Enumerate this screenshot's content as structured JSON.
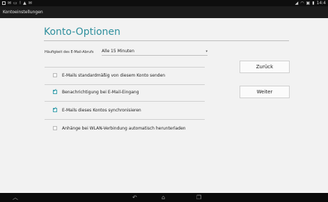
{
  "status_bar": {
    "left_icons": [
      "image-icon",
      "email-icon",
      "message-icon",
      "info-icon",
      "warning-icon",
      "mail-icon"
    ],
    "right_icons": [
      "signal-icon",
      "wifi-icon",
      "notification-icon",
      "battery-icon"
    ],
    "time": "14:4"
  },
  "action_bar": {
    "title": "Kontoeinstellungen"
  },
  "page": {
    "title": "Konto-Optionen",
    "frequency": {
      "label": "Häufigkeit des E-Mail-Abrufs",
      "value": "Alle 15 Minuten"
    },
    "options": [
      {
        "label": "E-Mails standardmäßig von diesem Konto senden",
        "checked": false
      },
      {
        "label": "Benachrichtigung bei E-Mail-Eingang",
        "checked": true
      },
      {
        "label": "E-Mails dieses Kontos synchronisieren",
        "checked": true
      },
      {
        "label": "Anhänge bei WLAN-Verbindung automatisch herunterladen",
        "checked": false
      }
    ]
  },
  "buttons": {
    "back": "Zurück",
    "next": "Weiter"
  },
  "nav_bar": {
    "icons": [
      "up-icon",
      "back-icon",
      "home-icon",
      "recents-icon"
    ]
  },
  "colors": {
    "accent": "#2f8f9d",
    "statusbar": "#0e0e0e",
    "actionbar": "#1c1c1c",
    "background": "#f2f2f2"
  }
}
